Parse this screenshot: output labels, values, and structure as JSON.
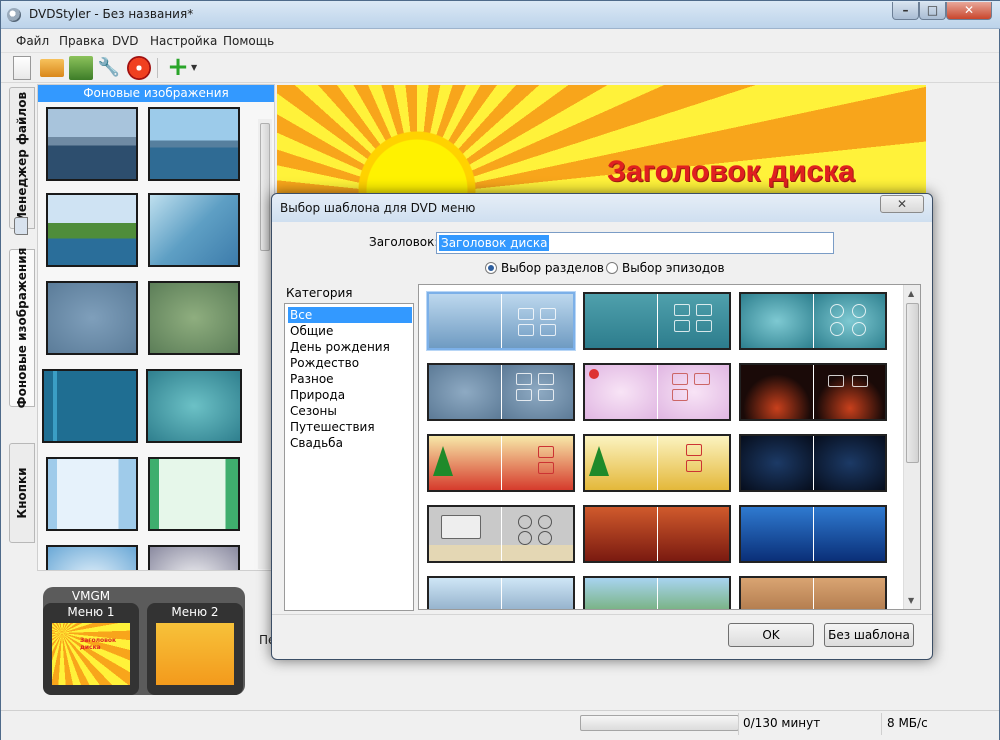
{
  "window": {
    "title": "DVDStyler - Без названия*"
  },
  "menu": [
    "Файл",
    "Правка",
    "DVD",
    "Настройка",
    "Помощь"
  ],
  "toolbar": {
    "icons": [
      "new-icon",
      "open-icon",
      "save-icon",
      "settings-wrench-icon",
      "burn-icon",
      "add-icon",
      "dropdown-icon"
    ]
  },
  "side_tabs": [
    "Менеджер файлов",
    "Фоновые изображения",
    "Кнопки"
  ],
  "backgrounds_panel": {
    "header": "Фоновые изображения"
  },
  "canvas": {
    "disc_title": "Заголовок диска"
  },
  "vmgm": {
    "label": "VMGM",
    "menus": [
      "Меню 1",
      "Меню 2"
    ],
    "thumb_title": "Заголовок диска"
  },
  "midtext": "Пе",
  "status": {
    "minutes": "0/130 минут",
    "rate": "8 МБ/с",
    "progress": 0
  },
  "dialog": {
    "title": "Выбор шаблона для DVD меню",
    "close_label": "✕",
    "title_label": "Заголовок:",
    "title_value": "Заголовок диска",
    "radio_chapters": "Выбор разделов",
    "radio_episodes": "Выбор эпизодов",
    "radio_selected": "chapters",
    "category_label": "Категория",
    "categories": [
      "Все",
      "Общие",
      "День рождения",
      "Рождество",
      "Разное",
      "Природа",
      "Сезоны",
      "Путешествия",
      "Свадьба"
    ],
    "selected_category": "Все",
    "ok_label": "OK",
    "no_template_label": "Без шаблона"
  }
}
